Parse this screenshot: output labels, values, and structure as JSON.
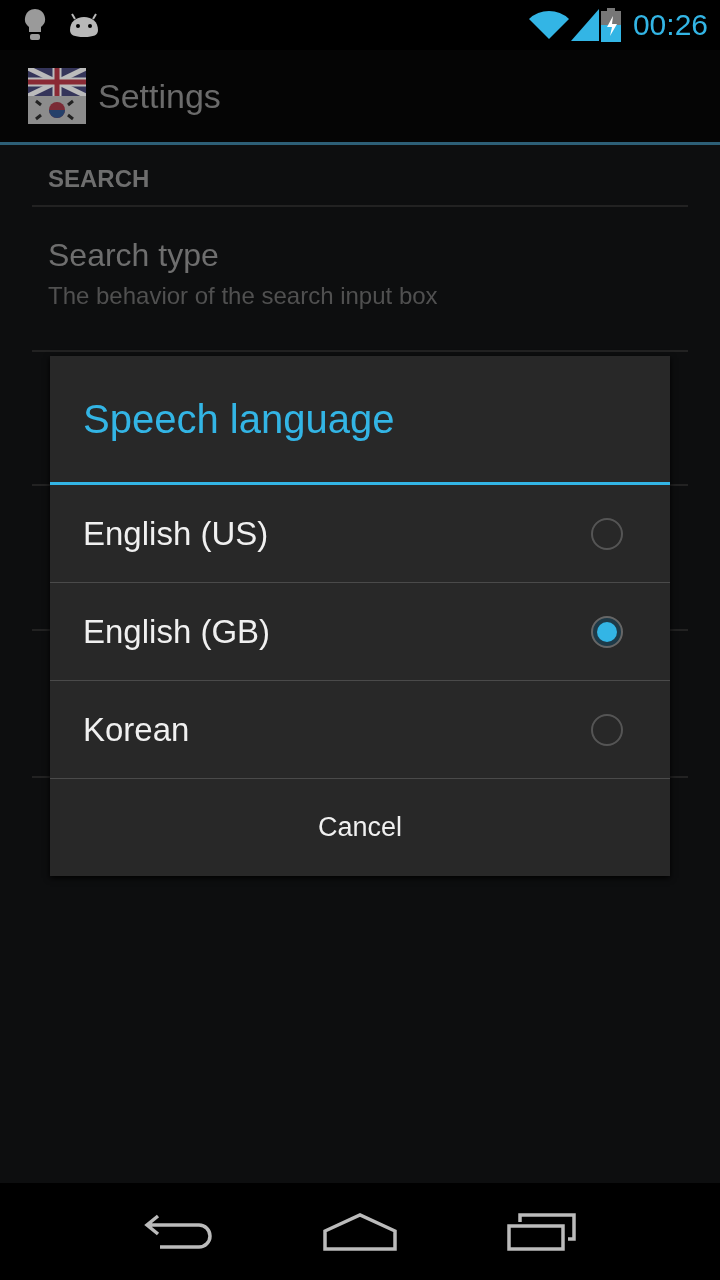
{
  "status_bar": {
    "time": "00:26"
  },
  "action_bar": {
    "title": "Settings"
  },
  "settings": {
    "section": "SEARCH",
    "items": [
      {
        "title": "Search type",
        "summary": "The behavior of the search input box"
      }
    ]
  },
  "dialog": {
    "title": "Speech language",
    "options": [
      {
        "label": "English (US)",
        "selected": false
      },
      {
        "label": "English (GB)",
        "selected": true
      },
      {
        "label": "Korean",
        "selected": false
      }
    ],
    "cancel": "Cancel"
  }
}
